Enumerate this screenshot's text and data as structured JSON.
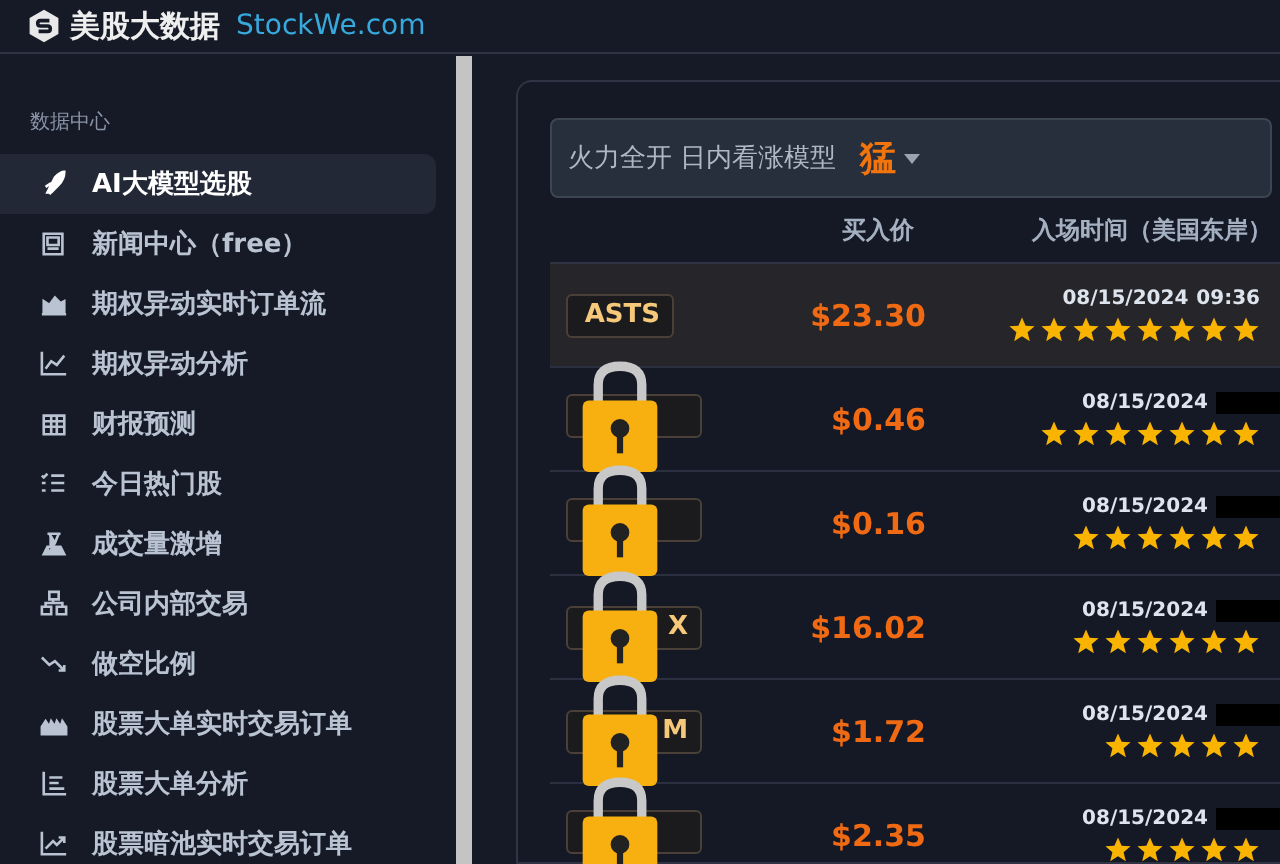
{
  "brand": {
    "name": "美股大数据",
    "domain": "StockWe.com"
  },
  "sidebar": {
    "section": "数据中心",
    "items": [
      {
        "label": "AI大模型选股",
        "selected": true
      },
      {
        "label": "新闻中心（free）",
        "selected": false
      },
      {
        "label": "期权异动实时订单流",
        "selected": false
      },
      {
        "label": "期权异动分析",
        "selected": false
      },
      {
        "label": "财报预测",
        "selected": false
      },
      {
        "label": "今日热门股",
        "selected": false
      },
      {
        "label": "成交量激增",
        "selected": false
      },
      {
        "label": "公司内部交易",
        "selected": false
      },
      {
        "label": "做空比例",
        "selected": false
      },
      {
        "label": "股票大单实时交易订单",
        "selected": false
      },
      {
        "label": "股票大单分析",
        "selected": false
      },
      {
        "label": "股票暗池实时交易订单",
        "selected": false
      }
    ]
  },
  "model_select": {
    "label": "火力全开 日内看涨模型",
    "value": "猛"
  },
  "table": {
    "columns": [
      "买入价",
      "入场时间（美国东岸）"
    ],
    "rows": [
      {
        "ticker": "ASTS",
        "selected": true,
        "locked": false,
        "price": "$23.30",
        "date": "08/15/2024",
        "time": "09:36",
        "stars": 8
      },
      {
        "ticker": "",
        "selected": false,
        "locked": true,
        "price": "$0.46",
        "date": "08/15/2024",
        "stars": 7
      },
      {
        "ticker": "",
        "selected": false,
        "locked": true,
        "price": "$0.16",
        "date": "08/15/2024",
        "stars": 6
      },
      {
        "ticker": "X",
        "selected": false,
        "locked": true,
        "price": "$16.02",
        "date": "08/15/2024",
        "stars": 6
      },
      {
        "ticker": "M",
        "selected": false,
        "locked": true,
        "price": "$1.72",
        "date": "08/15/2024",
        "stars": 5
      },
      {
        "ticker": "",
        "selected": false,
        "locked": true,
        "price": "$2.35",
        "date": "08/15/2024",
        "stars": 5
      }
    ]
  }
}
